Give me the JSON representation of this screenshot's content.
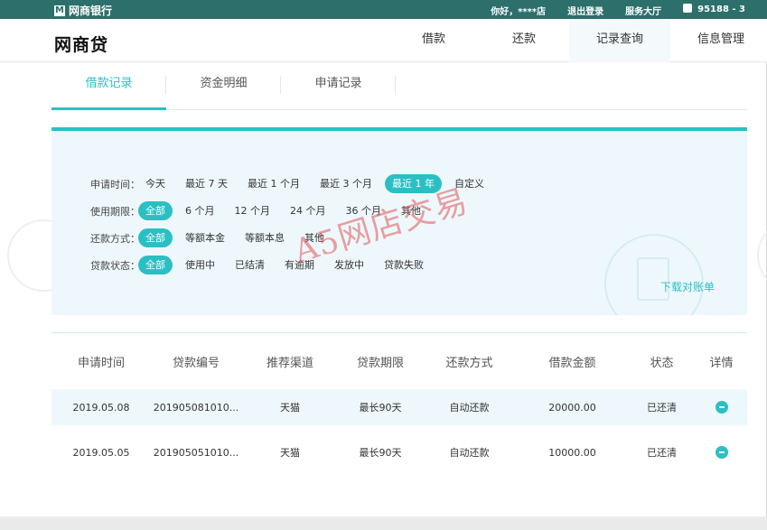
{
  "topbar": {
    "brand_mark": "M",
    "brand": "网商银行",
    "greeting": "你好，****店",
    "logout": "退出登录",
    "service": "服务大厅",
    "phone": "95188 - 3"
  },
  "navbar": {
    "logo": "网商贷",
    "items": [
      "借款",
      "还款",
      "记录查询",
      "信息管理"
    ]
  },
  "tabs": [
    "借款记录",
    "资金明细",
    "申请记录"
  ],
  "filters": {
    "apply_time": {
      "label": "申请时间：",
      "options": [
        "今天",
        "最近 7 天",
        "最近 1 个月",
        "最近 3 个月",
        "最近 1 年",
        "自定义"
      ],
      "selected": "最近 1 年"
    },
    "term": {
      "label": "使用期限：",
      "options": [
        "全部",
        "6 个月",
        "12 个月",
        "24 个月",
        "36 个月",
        "其他"
      ],
      "selected": "全部"
    },
    "repay_method": {
      "label": "还款方式：",
      "options": [
        "全部",
        "等额本金",
        "等额本息",
        "其他"
      ],
      "selected": "全部"
    },
    "loan_status": {
      "label": "贷款状态：",
      "options": [
        "全部",
        "使用中",
        "已结清",
        "有逾期",
        "发放中",
        "贷款失败"
      ],
      "selected": "全部"
    },
    "download": "下载对账单"
  },
  "watermark": "A5网店交易",
  "table": {
    "headers": [
      "申请时间",
      "贷款编号",
      "推荐渠道",
      "贷款期限",
      "还款方式",
      "借款金额",
      "状态",
      "详情"
    ],
    "rows": [
      [
        "2019.05.08",
        "201905081010...",
        "天猫",
        "最长90天",
        "自动还款",
        "20000.00",
        "已还清"
      ],
      [
        "2019.05.05",
        "201905051010...",
        "天猫",
        "最长90天",
        "自动还款",
        "10000.00",
        "已还清"
      ]
    ]
  },
  "icons": [
    "brand-logo-icon",
    "phone-icon",
    "download-illustration",
    "detail-icon"
  ],
  "colors": {
    "accent": "#2bbfc4",
    "topbar": "#2c6f6b",
    "filter_bg": "#eef8fc",
    "watermark": "#e25454"
  }
}
